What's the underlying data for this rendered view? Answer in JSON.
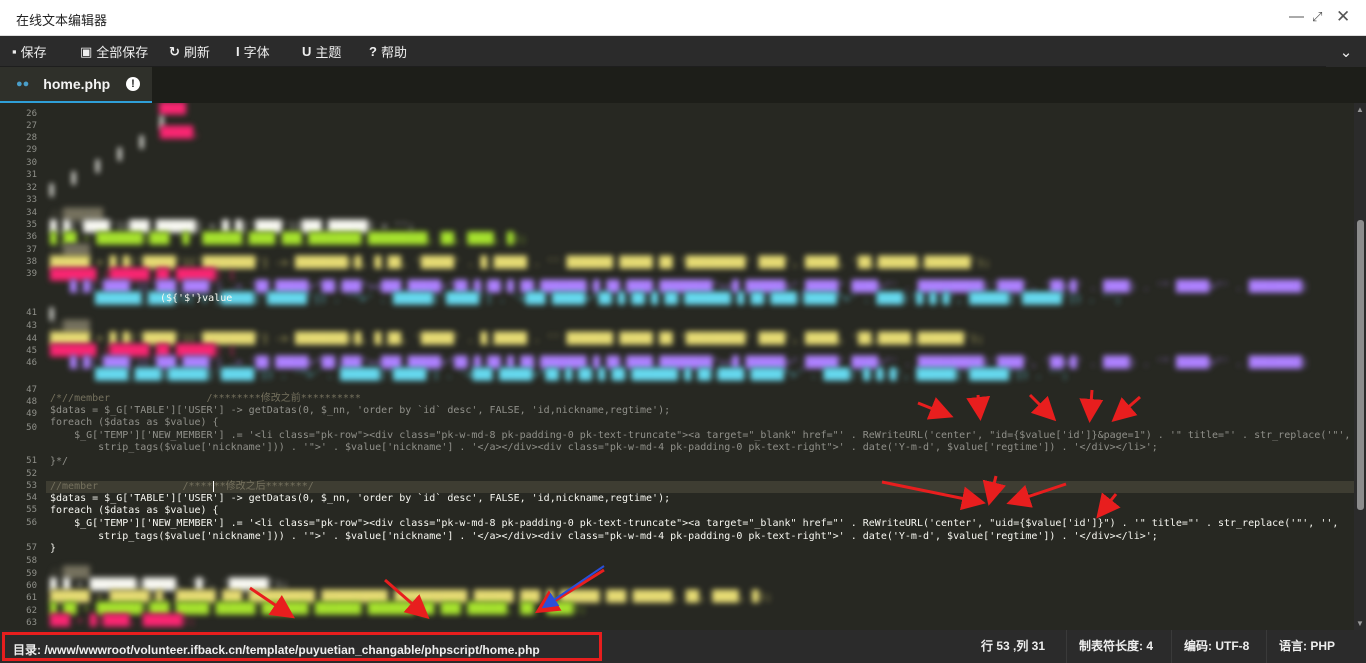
{
  "window": {
    "title": "在线文本编辑器"
  },
  "toolbar": {
    "save_label": "保存",
    "save_all_label": "全部保存",
    "refresh_label": "刷新",
    "font_label": "字体",
    "theme_label": "主题",
    "help_label": "帮助"
  },
  "tabs": [
    {
      "label": "home.php"
    }
  ],
  "editor": {
    "line_numbers": [
      "26",
      "27",
      "28",
      "29",
      "30",
      "31",
      "32",
      "33",
      "34",
      "35",
      "36",
      "37",
      "38",
      "39",
      "40",
      "41",
      "42",
      "43",
      "44",
      "45",
      "46",
      "47",
      "48",
      "49",
      "50",
      "51",
      "52",
      "53",
      "54",
      "55",
      "56",
      "57",
      "58",
      "59",
      "60",
      "61",
      "62",
      "63"
    ],
    "code": {
      "l40_visible": "(${'$'}value",
      "l47": "/*//member                /********修改之前**********",
      "l48": "$datas = $_G['TABLE']['USER'] -> getDatas(0, $_nn, 'order by `id` desc', FALSE, 'id,nickname,regtime');",
      "l49": "foreach ($datas as $value) {",
      "l50": "    $_G['TEMP']['NEW_MEMBER'] .= '<li class=\"pk-row\"><div class=\"pk-w-md-8 pk-padding-0 pk-text-truncate\"><a target=\"_blank\" href=\"' . ReWriteURL('center', \"id={$value['id']}&page=1\") . '\" title=\"' . str_replace('\"', '',",
      "l50b": "        strip_tags($value['nickname'])) . '\">' . $value['nickname'] . '</a></div><div class=\"pk-w-md-4 pk-padding-0 pk-text-right\">' . date('Y-m-d', $value['regtime']) . '</div></li>';",
      "l51": "}*/",
      "l53a": "//member              /****",
      "l53b": "**修改之后*******/",
      "l54": "$datas = $_G['TABLE']['USER'] -> getDatas(0, $_nn, 'order by `id` desc', FALSE, 'id,nickname,regtime');",
      "l55": "foreach ($datas as $value) {",
      "l56": "    $_G['TEMP']['NEW_MEMBER'] .= '<li class=\"pk-row\"><div class=\"pk-w-md-8 pk-padding-0 pk-text-truncate\"><a target=\"_blank\" href=\"' . ReWriteURL('center', \"uid={$value['id']}\") . '\" title=\"' . str_replace('\"', '',",
      "l56b": "        strip_tags($value['nickname'])) . '\">' . $value['nickname'] . '</a></div><div class=\"pk-w-md-4 pk-padding-0 pk-text-right\">' . date('Y-m-d', $value['regtime']) . '</div></li>';",
      "l57": "}"
    }
  },
  "status": {
    "dir_label": "目录:",
    "dir_path": "/www/wwwroot/volunteer.ifback.cn/template/puyuetian_changable/phpscript/home.php",
    "cursor": "行 53 ,列 31",
    "tab_size": "制表符长度: 4",
    "encoding": "编码: UTF-8",
    "language": "语言: PHP"
  },
  "colors": {
    "accent": "#2f9fd8",
    "highlight_box": "#e81e1e",
    "arrow": "#e81e1e",
    "arrow_blue": "#2b4fd8",
    "background": "#272822"
  },
  "icons": [
    "save-icon",
    "save-all-icon",
    "refresh-icon",
    "font-icon",
    "theme-icon",
    "help-icon",
    "file-icon",
    "info-icon",
    "chevron-down-icon",
    "minimize-icon",
    "maximize-icon",
    "close-icon"
  ]
}
